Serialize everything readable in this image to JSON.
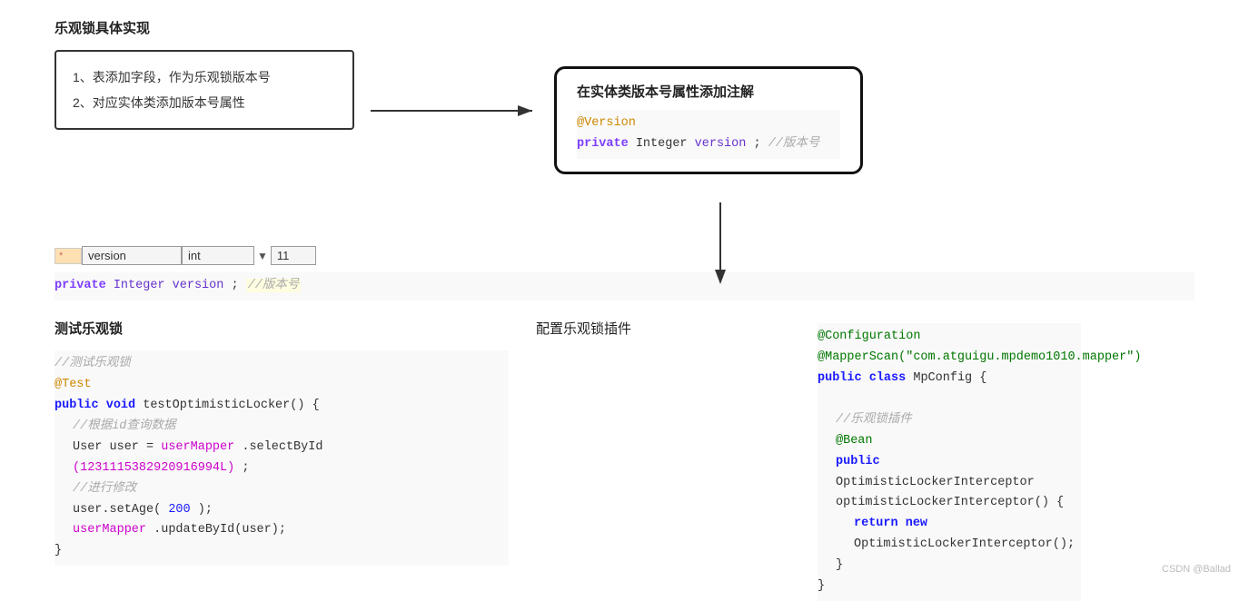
{
  "page": {
    "title": "乐观锁具体实现",
    "watermark": "CSDN @Ballad"
  },
  "left_box": {
    "line1": "1、表添加字段，作为乐观锁版本号",
    "line2": "2、对应实体类添加版本号属性"
  },
  "right_annotation_box": {
    "title": "在实体类版本号属性添加注解",
    "code": [
      {
        "type": "annotation",
        "text": "@Version"
      },
      {
        "type": "code",
        "text": "private Integer version;//版本号"
      }
    ]
  },
  "db_row": {
    "key_marker": "*",
    "field_name": "version",
    "field_type": "int",
    "field_value": "11"
  },
  "entity_code": {
    "line": "private Integer version;//版本号"
  },
  "test_section": {
    "title": "测试乐观锁"
  },
  "test_code": [
    {
      "indent": 0,
      "text": "//测试乐观锁",
      "style": "comment"
    },
    {
      "indent": 0,
      "text": "@Test",
      "style": "annotation"
    },
    {
      "indent": 0,
      "text": "public void testOptimisticLocker() {",
      "style": "method"
    },
    {
      "indent": 1,
      "text": "//根据id查询数据",
      "style": "comment"
    },
    {
      "indent": 1,
      "text": "User user = userMapper.selectById",
      "style": "normal"
    },
    {
      "indent": 1,
      "text": "(1231115382920916994L);",
      "style": "normal_blue"
    },
    {
      "indent": 1,
      "text": "//进行修改",
      "style": "comment"
    },
    {
      "indent": 1,
      "text": "user.setAge(200);",
      "style": "normal"
    },
    {
      "indent": 1,
      "text": "userMapper.updateById(user);",
      "style": "normal_usermapper"
    },
    {
      "indent": 0,
      "text": "}",
      "style": "normal"
    }
  ],
  "config_section": {
    "label": "配置乐观锁插件"
  },
  "config_code": [
    {
      "text": "@Configuration",
      "style": "annotation-green"
    },
    {
      "text": "@MapperScan(\"com.atguigu.mpdemo1010.mapper\")",
      "style": "mapperannotation"
    },
    {
      "text": "public class MpConfig {",
      "style": "class"
    },
    {
      "text": "",
      "style": "blank"
    },
    {
      "text": "    //乐观锁插件",
      "style": "comment"
    },
    {
      "text": "    @Bean",
      "style": "annotation-green"
    },
    {
      "text": "    public OptimisticLockerInterceptor",
      "style": "method"
    },
    {
      "text": "optimisticLockerInterceptor() {",
      "style": "normal"
    },
    {
      "text": "        return new OptimisticLockerInterceptor();",
      "style": "return"
    },
    {
      "text": "    }",
      "style": "normal"
    },
    {
      "text": "}",
      "style": "normal"
    }
  ]
}
